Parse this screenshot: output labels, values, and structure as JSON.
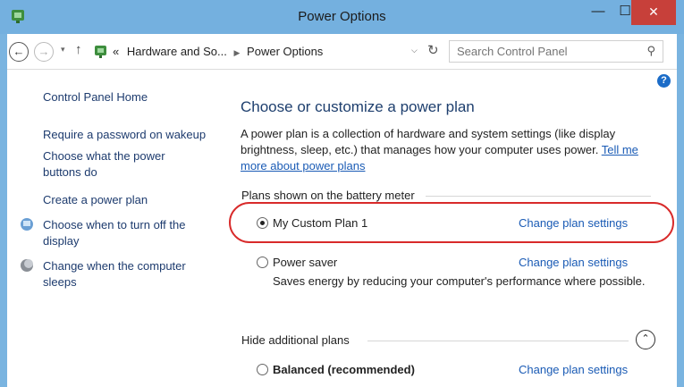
{
  "window": {
    "title": "Power Options",
    "minimize": "—",
    "maximize": "☐",
    "close": "✕"
  },
  "address": {
    "back": "←",
    "forward": "→",
    "dropdown": "▾",
    "up": "↑",
    "breadcrumb_prefix": "«",
    "breadcrumb_parent": "Hardware and So...",
    "breadcrumb_current": "Power Options",
    "breadcrumb_sep": "▶",
    "addr_dropdown": "⌵",
    "refresh": "↻",
    "search_placeholder": "Search Control Panel",
    "search_icon": "⚲"
  },
  "sidebar": {
    "home": "Control Panel Home",
    "items": [
      {
        "label": "Require a password on wakeup"
      },
      {
        "label": "Choose what the power buttons do"
      },
      {
        "label": "Create a power plan"
      },
      {
        "label": "Choose when to turn off the display",
        "icon": "display-icon"
      },
      {
        "label": "Change when the computer sleeps",
        "icon": "moon-icon"
      }
    ]
  },
  "main": {
    "help": "?",
    "heading": "Choose or customize a power plan",
    "description": "A power plan is a collection of hardware and system settings (like display brightness, sleep, etc.) that manages how your computer uses power.",
    "description_link": "Tell me more about power plans",
    "battery_section": "Plans shown on the battery meter",
    "additional_section": "Hide additional plans",
    "collapse_icon": "⌃",
    "plans": [
      {
        "name": "My Custom Plan 1",
        "selected": true,
        "link": "Change plan settings",
        "desc": ""
      },
      {
        "name": "Power saver",
        "selected": false,
        "link": "Change plan settings",
        "desc": "Saves energy by reducing your computer's performance where possible."
      },
      {
        "name": "Balanced (recommended)",
        "selected": false,
        "link": "Change plan settings",
        "desc": ""
      }
    ]
  },
  "colors": {
    "titlebar": "#74b0df",
    "close_button": "#c7403a",
    "link": "#1a5bb5",
    "heading": "#1e3f6e",
    "highlight": "#d82a2a"
  }
}
